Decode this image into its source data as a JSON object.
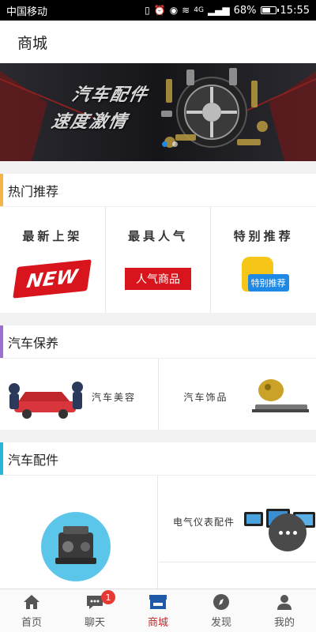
{
  "status_bar": {
    "carrier": "中国移动",
    "battery": "68%",
    "battery_level": 0.68,
    "time": "15:55",
    "signal_text": "4G"
  },
  "header": {
    "title": "商城"
  },
  "banner": {
    "line1": "汽车配件",
    "line2": "速度激情",
    "slide_count": 2,
    "active_slide": 0
  },
  "hot": {
    "title": "热门推荐",
    "accent": "#f4b44a",
    "items": [
      {
        "title": "最新上架",
        "badge": "NEW"
      },
      {
        "title": "最具人气",
        "badge": "人气商品"
      },
      {
        "title": "特别推荐",
        "badge": "特别推荐"
      }
    ]
  },
  "care": {
    "title": "汽车保养",
    "accent": "#9b6fd0",
    "items": [
      {
        "label": "汽车美容"
      },
      {
        "label": "汽车饰品"
      }
    ]
  },
  "parts": {
    "title": "汽车配件",
    "accent": "#27b5d8",
    "items": [
      {
        "label": "电气仪表配件"
      }
    ]
  },
  "bottom_nav": {
    "items": [
      {
        "label": "首页",
        "icon": "home-icon"
      },
      {
        "label": "聊天",
        "icon": "chat-icon",
        "badge": "1"
      },
      {
        "label": "商城",
        "icon": "store-icon",
        "active": true
      },
      {
        "label": "发现",
        "icon": "discover-icon"
      },
      {
        "label": "我的",
        "icon": "profile-icon"
      }
    ]
  }
}
